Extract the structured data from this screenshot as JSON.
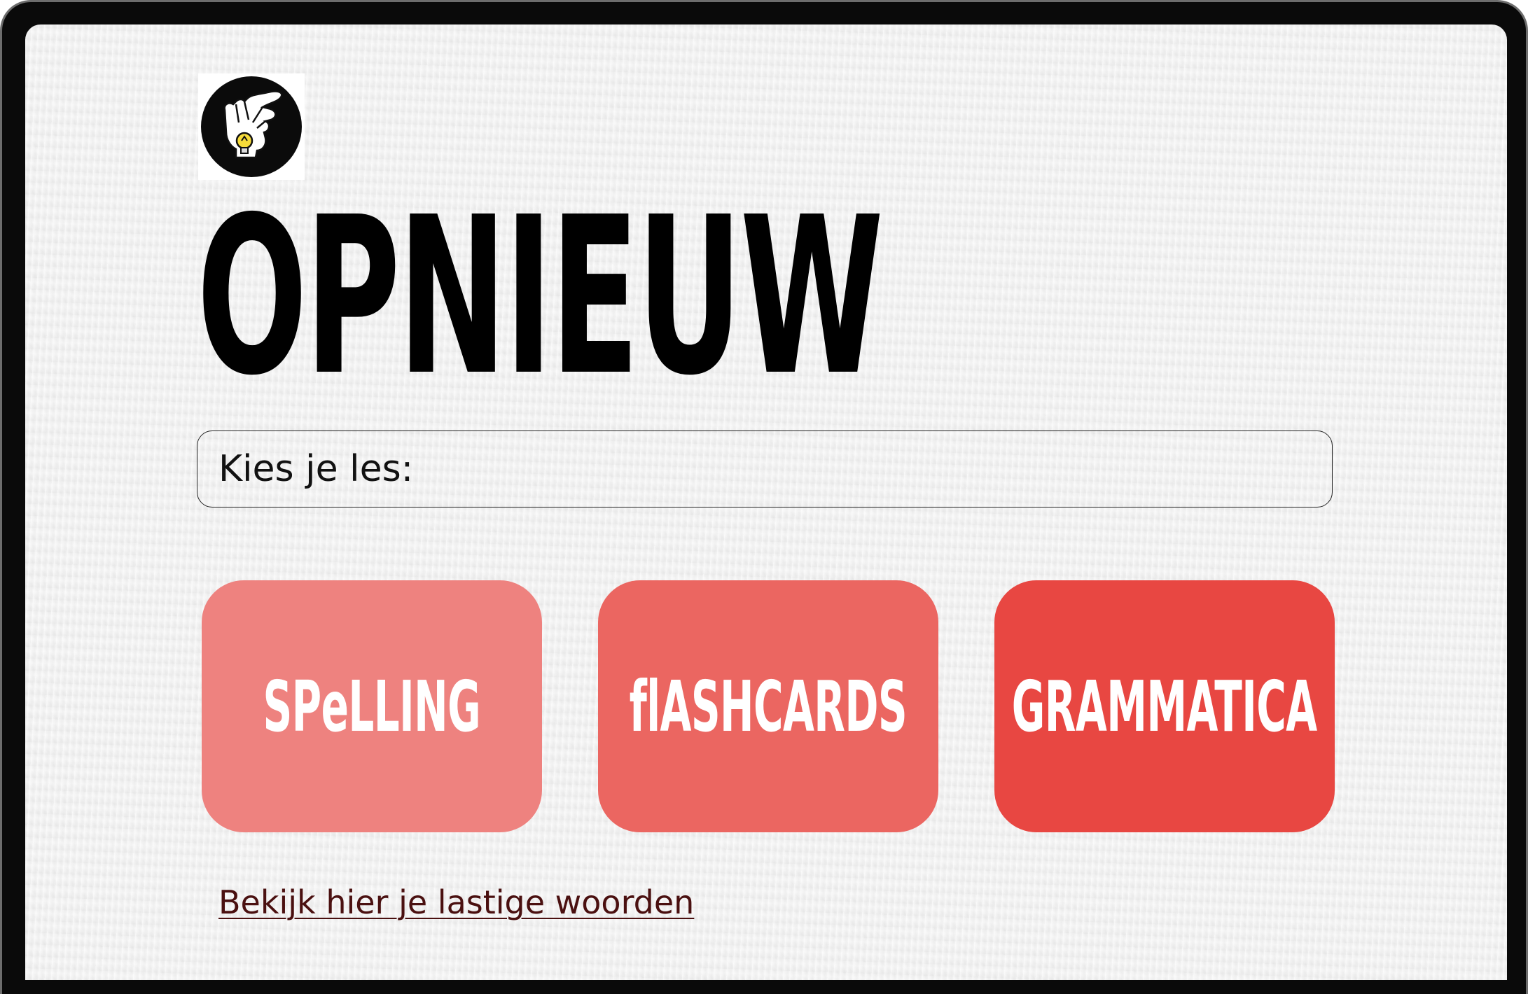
{
  "app": {
    "title": "OPNIEUW",
    "logo_icon": "hand-lightbulb-icon"
  },
  "lesson_picker": {
    "label": "Kies je les:"
  },
  "lessons": [
    {
      "label": "SPeLLING",
      "color": "#ee827f"
    },
    {
      "label": "flASHCARDS",
      "color": "#eb6661"
    },
    {
      "label": "GRAMMATICA",
      "color": "#e84742"
    }
  ],
  "footer": {
    "difficult_words_link": "Bekijk hier je lastige woorden"
  },
  "colors": {
    "background": "#f2f2f2",
    "link": "#4a1010",
    "frame": "#0a0a0a"
  }
}
